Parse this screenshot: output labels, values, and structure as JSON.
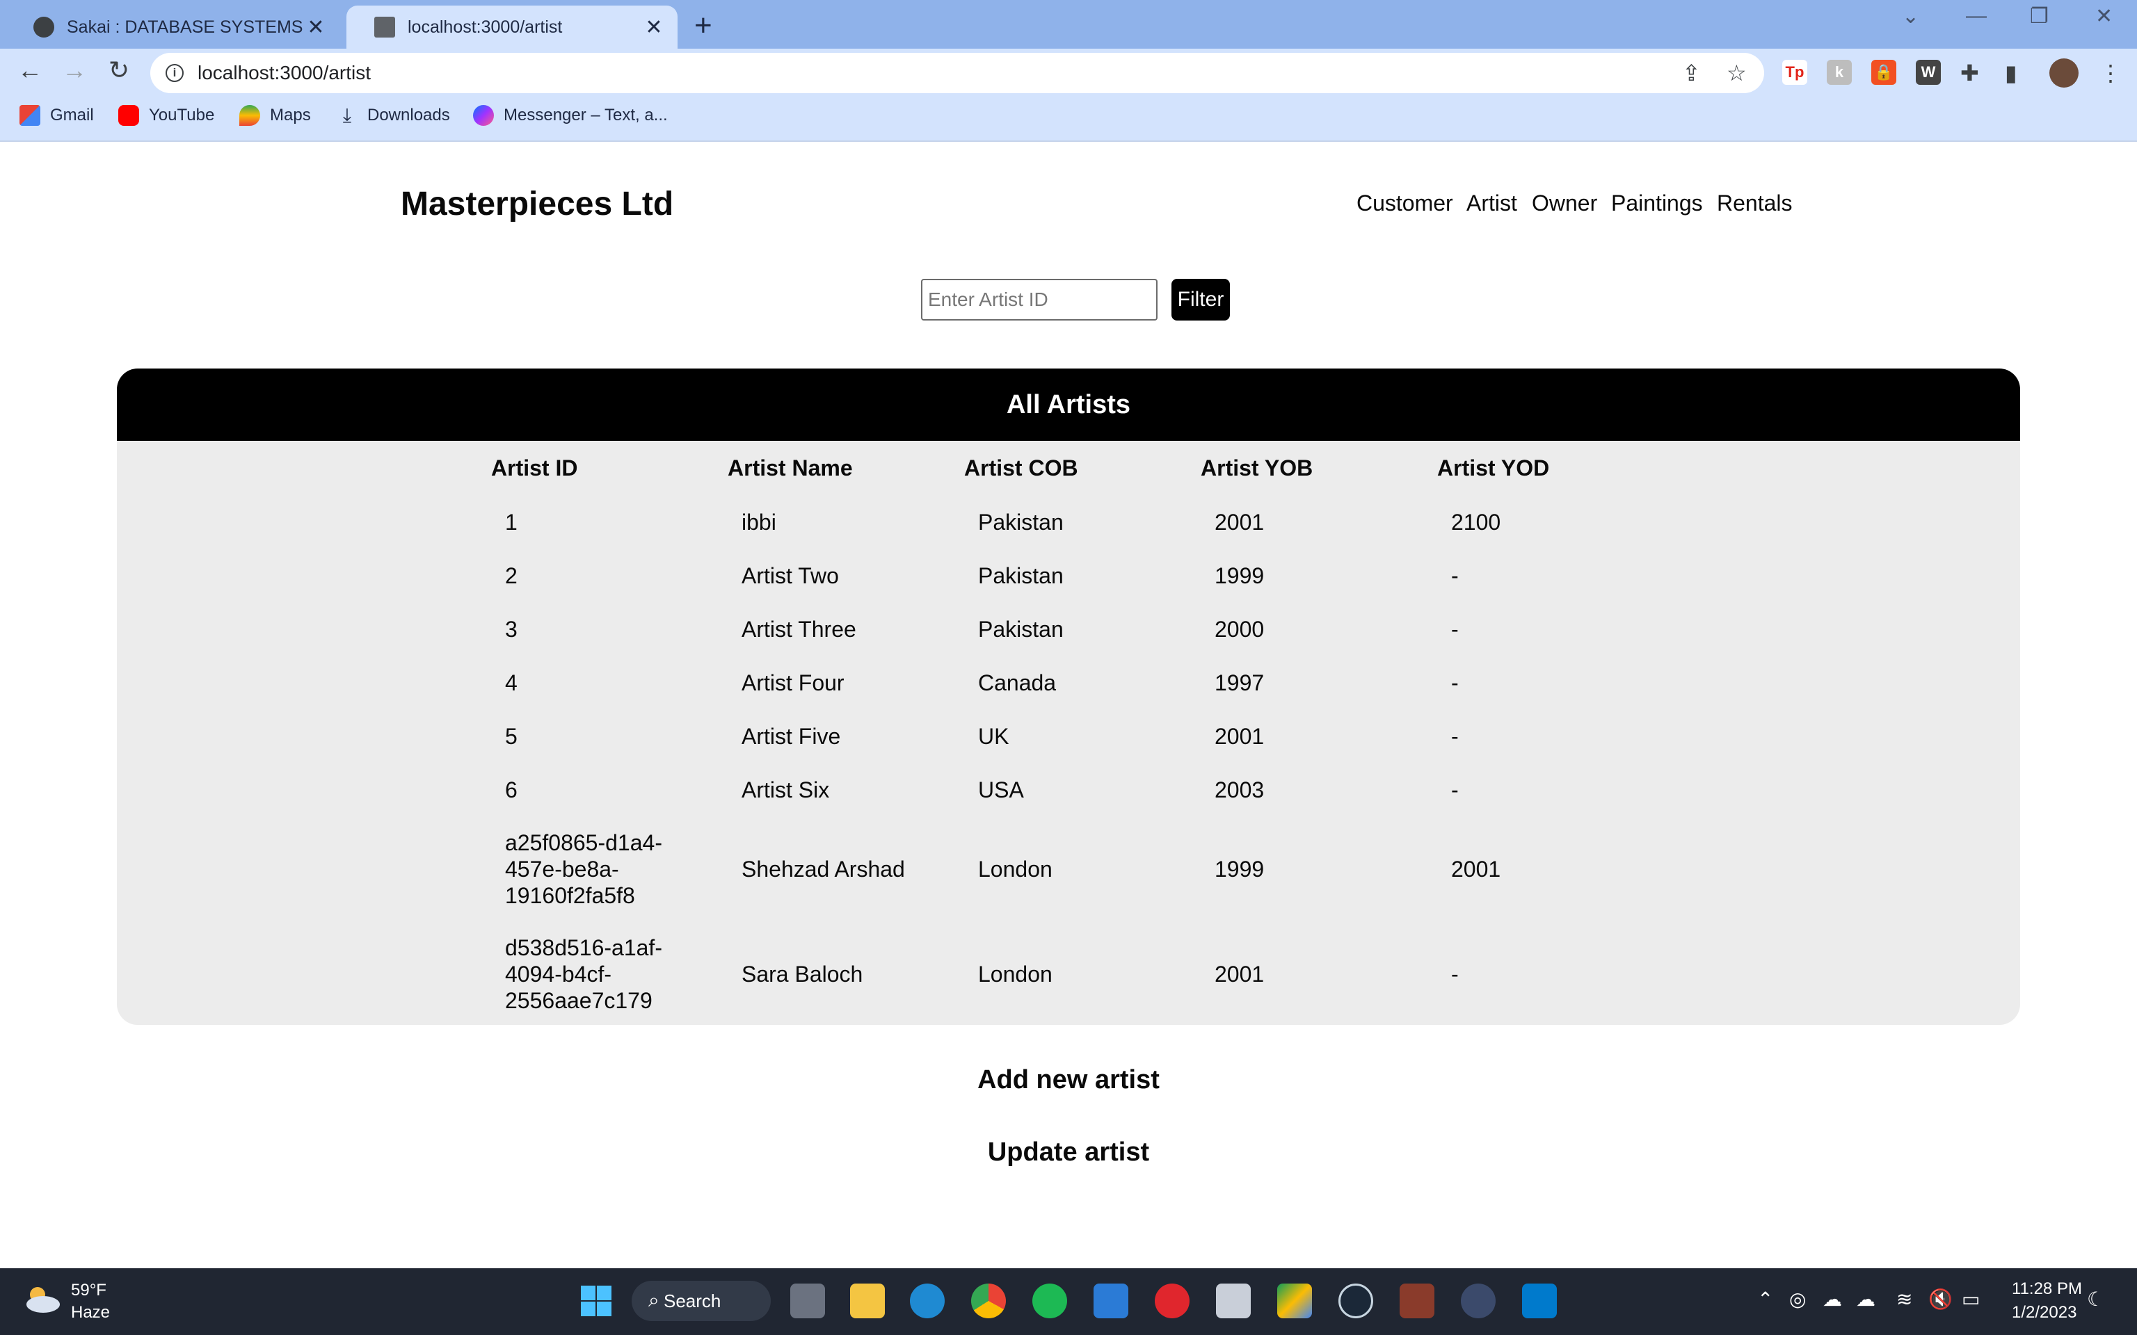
{
  "browser": {
    "tabs": [
      {
        "title": "Sakai : DATABASE SYSTEMS (Clas",
        "active": false
      },
      {
        "title": "localhost:3000/artist",
        "active": true
      }
    ],
    "url": "localhost:3000/artist",
    "bookmarks": [
      "Gmail",
      "YouTube",
      "Maps",
      "Downloads",
      "Messenger – Text, a..."
    ]
  },
  "site": {
    "brand": "Masterpieces Ltd",
    "nav": [
      "Customer",
      "Artist",
      "Owner",
      "Paintings",
      "Rentals"
    ]
  },
  "filter": {
    "placeholder": "Enter Artist ID",
    "value": "",
    "button_label": "Filter"
  },
  "table": {
    "title": "All Artists",
    "columns": [
      "Artist ID",
      "Artist Name",
      "Artist COB",
      "Artist YOB",
      "Artist YOD"
    ],
    "rows": [
      {
        "id": "1",
        "name": "ibbi",
        "cob": "Pakistan",
        "yob": "2001",
        "yod": "2100"
      },
      {
        "id": "2",
        "name": "Artist Two",
        "cob": "Pakistan",
        "yob": "1999",
        "yod": "-"
      },
      {
        "id": "3",
        "name": "Artist Three",
        "cob": "Pakistan",
        "yob": "2000",
        "yod": "-"
      },
      {
        "id": "4",
        "name": "Artist Four",
        "cob": "Canada",
        "yob": "1997",
        "yod": "-"
      },
      {
        "id": "5",
        "name": "Artist Five",
        "cob": "UK",
        "yob": "2001",
        "yod": "-"
      },
      {
        "id": "6",
        "name": "Artist Six",
        "cob": "USA",
        "yob": "2003",
        "yod": "-"
      },
      {
        "id_lines": [
          "a25f0865-d1a4-",
          "457e-be8a-",
          "19160f2fa5f8"
        ],
        "name": "Shehzad Arshad",
        "cob": "London",
        "yob": "1999",
        "yod": "2001"
      },
      {
        "id_lines": [
          "d538d516-a1af-",
          "4094-b4cf-",
          "2556aae7c179"
        ],
        "name": "Sara Baloch",
        "cob": "London",
        "yob": "2001",
        "yod": "-"
      }
    ]
  },
  "actions": {
    "add": "Add new artist",
    "update": "Update artist"
  },
  "taskbar": {
    "weather_temp": "59°F",
    "weather_cond": "Haze",
    "search_label": "Search",
    "time": "11:28 PM",
    "date": "1/2/2023"
  },
  "colors": {
    "tab_strip": "#8fb2ea",
    "toolbar": "#d3e3fd",
    "table_header": "#000000",
    "table_body": "#ececec",
    "taskbar": "#202632"
  }
}
